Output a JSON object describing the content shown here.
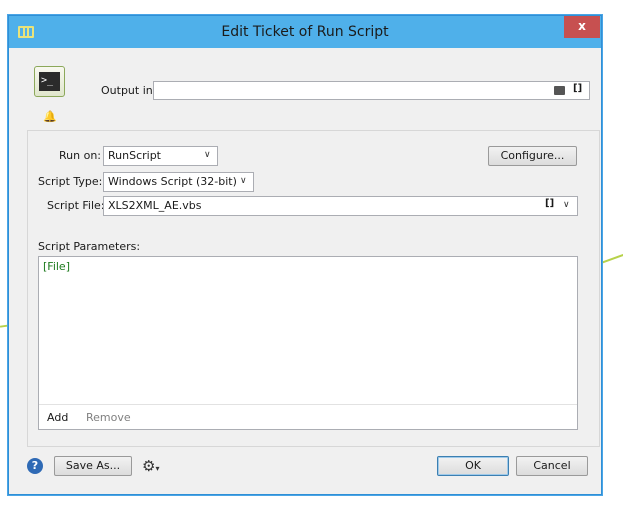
{
  "window": {
    "title": "Edit Ticket of Run Script",
    "close_label": "x"
  },
  "output": {
    "label": "Output in:",
    "value": "",
    "folder_icon": "folder-icon",
    "var_icon_label": "[]"
  },
  "run_on": {
    "label": "Run on:",
    "value": "RunScript"
  },
  "configure_label": "Configure...",
  "script_type": {
    "label": "Script Type:",
    "value": "Windows Script (32-bit)"
  },
  "script_file": {
    "label": "Script File:",
    "value": "XLS2XML_AE.vbs",
    "var_icon_label": "[]"
  },
  "params": {
    "label": "Script Parameters:",
    "items": [
      "[File]"
    ],
    "add_label": "Add",
    "remove_label": "Remove"
  },
  "footer": {
    "help_label": "?",
    "save_as_label": "Save As...",
    "ok_label": "OK",
    "cancel_label": "Cancel"
  },
  "icons": {
    "terminal_prompt": ">_"
  },
  "colors": {
    "titlebar": "#4fb0ea",
    "close": "#c75050",
    "param_text": "#1e7b1e"
  }
}
